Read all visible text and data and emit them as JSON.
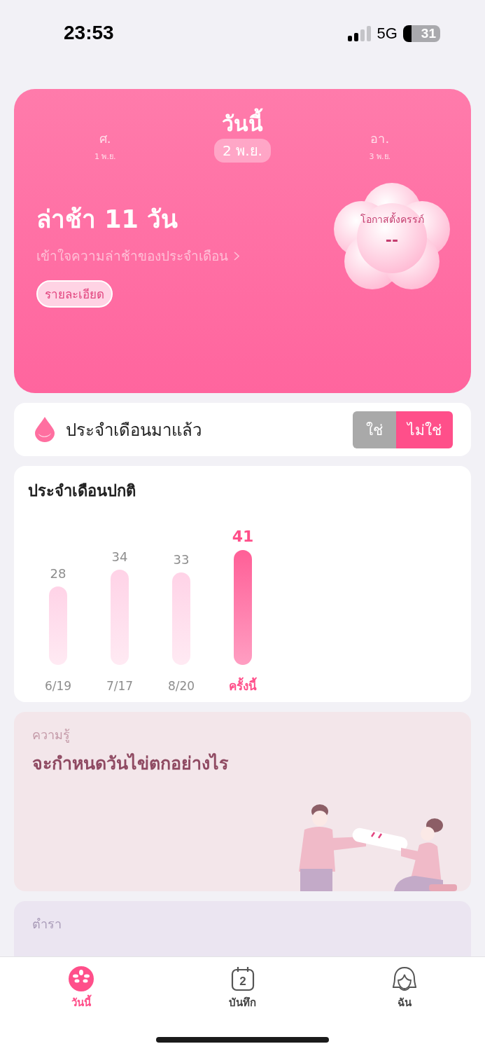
{
  "status_bar": {
    "time": "23:53",
    "network": "5G",
    "battery": "31"
  },
  "day_nav": [
    {
      "weekday": "ศ.",
      "date": "1 พ.ย.",
      "selected": false
    },
    {
      "weekday": "วันนี้",
      "date": "2 พ.ย.",
      "selected": true
    },
    {
      "weekday": "อา.",
      "date": "3 พ.ย.",
      "selected": false
    }
  ],
  "status": {
    "headline": "ล่าช้า 11 วัน",
    "link": "เข้าใจความล่าช้าของประจำเดือน",
    "details_button": "รายละเอียด"
  },
  "pregnancy_chance": {
    "label": "โอกาสตั้งครรภ์",
    "value": "--"
  },
  "period_started": {
    "label": "ประจำเดือนมาแล้ว",
    "options": [
      {
        "label": "ใช่",
        "selected": false
      },
      {
        "label": "ไม่ใช่",
        "selected": true
      }
    ]
  },
  "cycle_card": {
    "title": "ประจำเดือนปกติ",
    "bars": [
      {
        "current": false
      },
      {
        "current": false
      },
      {
        "current": false
      },
      {
        "current": true
      }
    ],
    "chart_data": {
      "type": "bar",
      "categories": [
        "6/19",
        "7/17",
        "8/20",
        "ครั้งนี้"
      ],
      "series": [
        {
          "color": "#ffd3e7",
          "values": [
            28,
            34,
            33,
            41
          ]
        }
      ],
      "data_labels": true
    }
  },
  "articles": [
    {
      "kind": "knowledge",
      "category": "ความรู้",
      "title": "จะกำหนดวันไข่ตกอย่างไร"
    },
    {
      "kind": "textbook",
      "category": "ตำรา"
    }
  ],
  "tab_bar": [
    {
      "label": "วันนี้",
      "selected": true
    },
    {
      "label": "บันทึก",
      "selected": false,
      "badge": "2"
    },
    {
      "label": "ฉัน",
      "selected": false
    }
  ]
}
